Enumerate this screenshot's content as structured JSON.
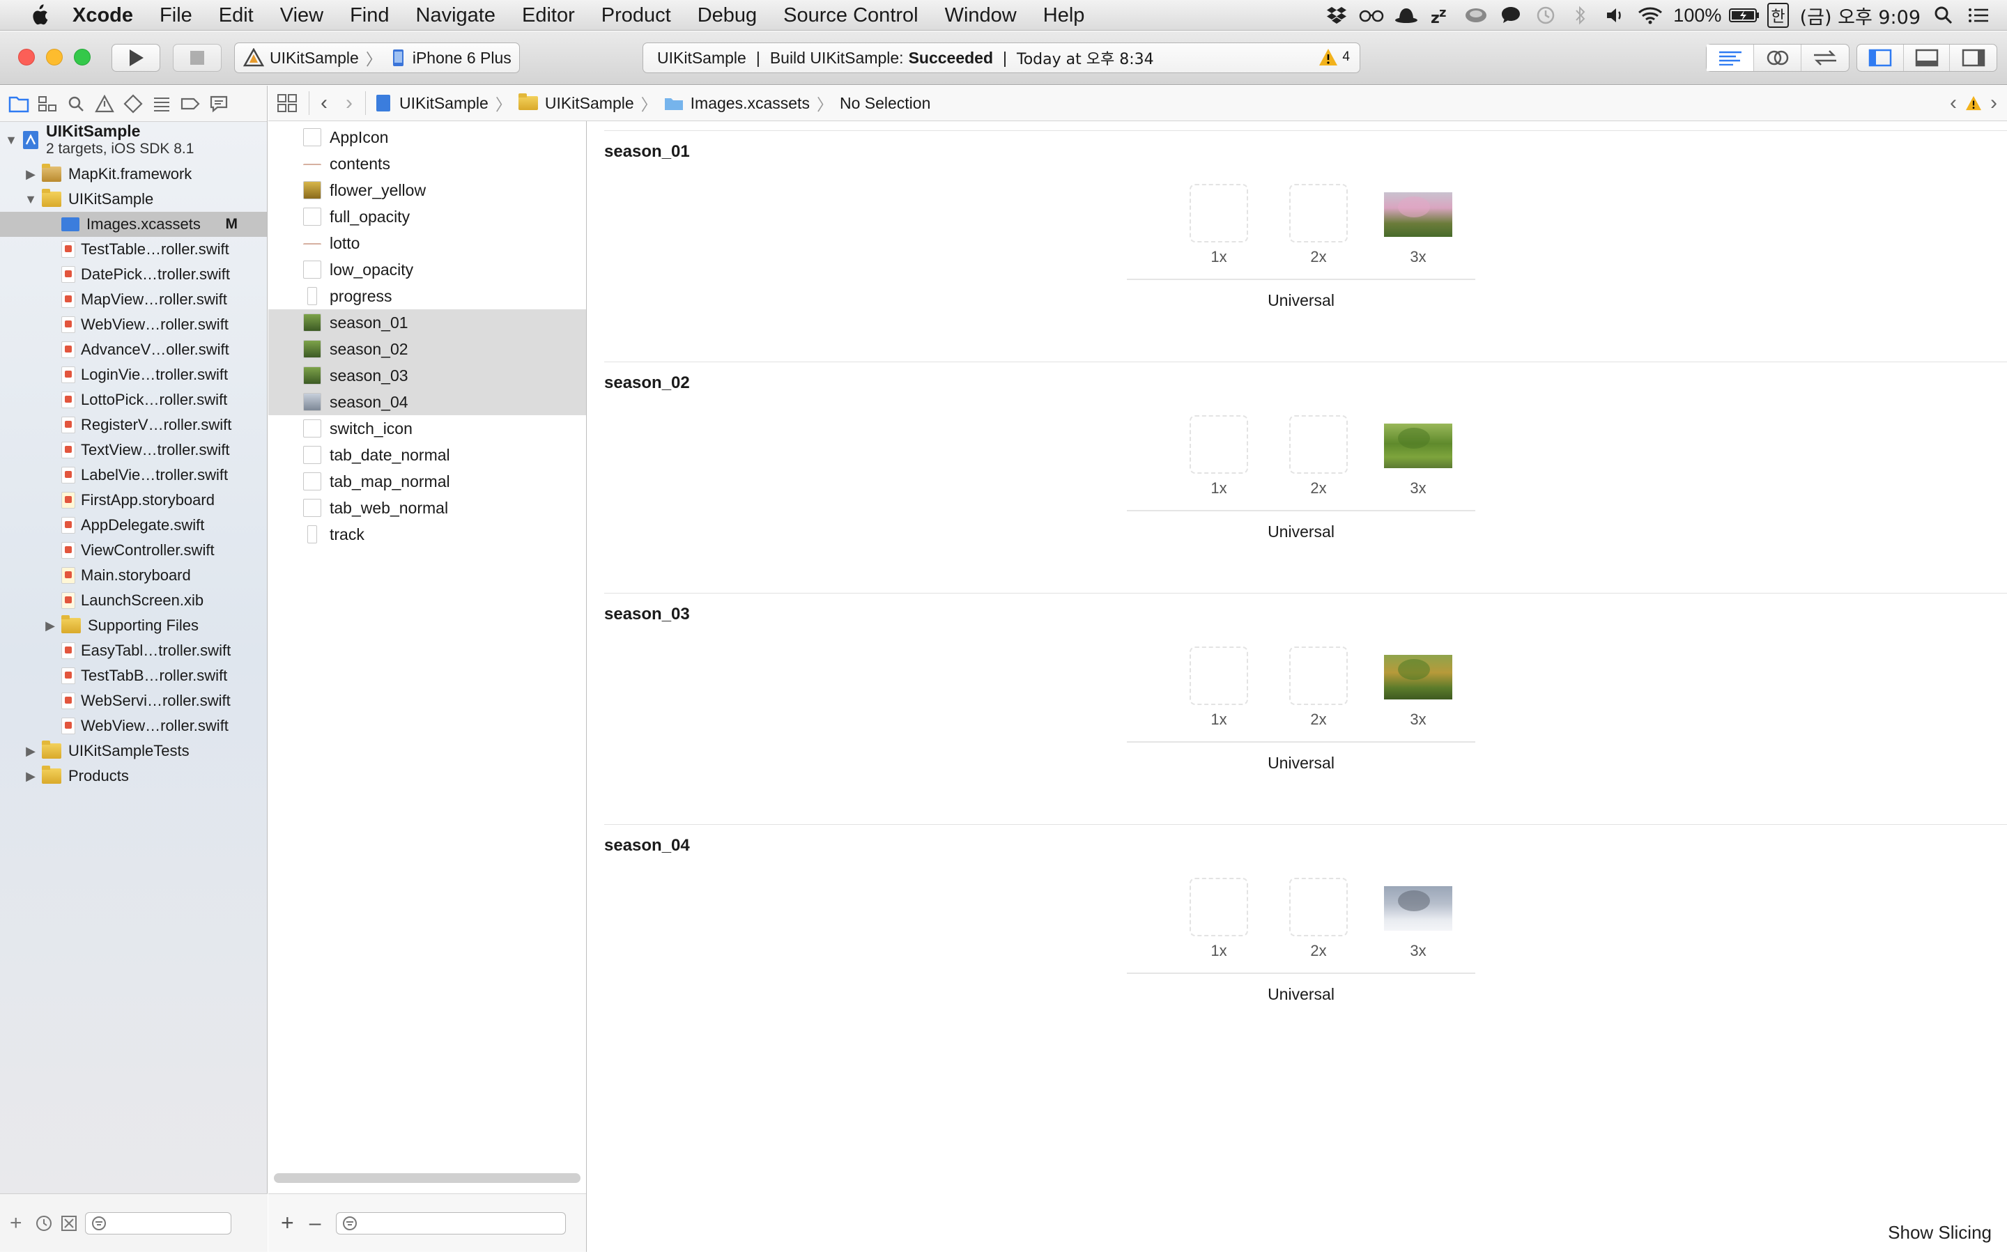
{
  "menubar": {
    "apple": "",
    "items": [
      "Xcode",
      "File",
      "Edit",
      "View",
      "Find",
      "Navigate",
      "Editor",
      "Product",
      "Debug",
      "Source Control",
      "Window",
      "Help"
    ],
    "battery": "100%",
    "input_method": "한",
    "clock": "(금) 오후 9:09"
  },
  "toolbar": {
    "scheme_target": "UIKitSample",
    "scheme_device": "iPhone 6 Plus",
    "activity_project": "UIKitSample",
    "activity_build_prefix": "Build UIKitSample:",
    "activity_build_status": "Succeeded",
    "activity_time": "Today at 오후 8:34",
    "warning_count": "4"
  },
  "navigator": {
    "project_name": "UIKitSample",
    "project_sub": "2 targets, iOS SDK 8.1",
    "items": [
      {
        "label": "MapKit.framework",
        "kind": "framework"
      },
      {
        "label": "UIKitSample",
        "kind": "folder"
      },
      {
        "label": "Images.xcassets",
        "kind": "xcassets",
        "badge": "M"
      },
      {
        "label": "TestTable…roller.swift",
        "kind": "swift"
      },
      {
        "label": "DatePick…troller.swift",
        "kind": "swift"
      },
      {
        "label": "MapView…roller.swift",
        "kind": "swift"
      },
      {
        "label": "WebView…roller.swift",
        "kind": "swift"
      },
      {
        "label": "AdvanceV…oller.swift",
        "kind": "swift"
      },
      {
        "label": "LoginVie…troller.swift",
        "kind": "swift"
      },
      {
        "label": "LottoPick…roller.swift",
        "kind": "swift"
      },
      {
        "label": "RegisterV…roller.swift",
        "kind": "swift"
      },
      {
        "label": "TextView…troller.swift",
        "kind": "swift"
      },
      {
        "label": "LabelVie…troller.swift",
        "kind": "swift"
      },
      {
        "label": "FirstApp.storyboard",
        "kind": "storyboard"
      },
      {
        "label": "AppDelegate.swift",
        "kind": "swift"
      },
      {
        "label": "ViewController.swift",
        "kind": "swift"
      },
      {
        "label": "Main.storyboard",
        "kind": "storyboard"
      },
      {
        "label": "LaunchScreen.xib",
        "kind": "xib"
      },
      {
        "label": "Supporting Files",
        "kind": "folder"
      },
      {
        "label": "EasyTabl…troller.swift",
        "kind": "swift"
      },
      {
        "label": "TestTabB…roller.swift",
        "kind": "swift"
      },
      {
        "label": "WebServi…roller.swift",
        "kind": "swift"
      },
      {
        "label": "WebView…roller.swift",
        "kind": "swift"
      },
      {
        "label": "UIKitSampleTests",
        "kind": "folder"
      },
      {
        "label": "Products",
        "kind": "folder"
      }
    ]
  },
  "jumpbar": {
    "crumbs": [
      "UIKitSample",
      "UIKitSample",
      "Images.xcassets",
      "No Selection"
    ]
  },
  "assets": [
    "AppIcon",
    "contents",
    "flower_yellow",
    "full_opacity",
    "lotto",
    "low_opacity",
    "progress",
    "season_01",
    "season_02",
    "season_03",
    "season_04",
    "switch_icon",
    "tab_date_normal",
    "tab_map_normal",
    "tab_web_normal",
    "track"
  ],
  "imagesets": [
    {
      "name": "season_01",
      "scales": [
        "1x",
        "2x",
        "3x"
      ],
      "device": "Universal"
    },
    {
      "name": "season_02",
      "scales": [
        "1x",
        "2x",
        "3x"
      ],
      "device": "Universal"
    },
    {
      "name": "season_03",
      "scales": [
        "1x",
        "2x",
        "3x"
      ],
      "device": "Universal"
    },
    {
      "name": "season_04",
      "scales": [
        "1x",
        "2x",
        "3x"
      ],
      "device": "Universal"
    }
  ],
  "detail": {
    "show_slicing": "Show Slicing"
  },
  "colors": {
    "accent": "#2f7bf2",
    "selection": "#c4c4c4",
    "warning": "#f2b21c",
    "close": "#fc5f57",
    "minimize": "#fdbc2e",
    "zoom": "#34c84a"
  }
}
